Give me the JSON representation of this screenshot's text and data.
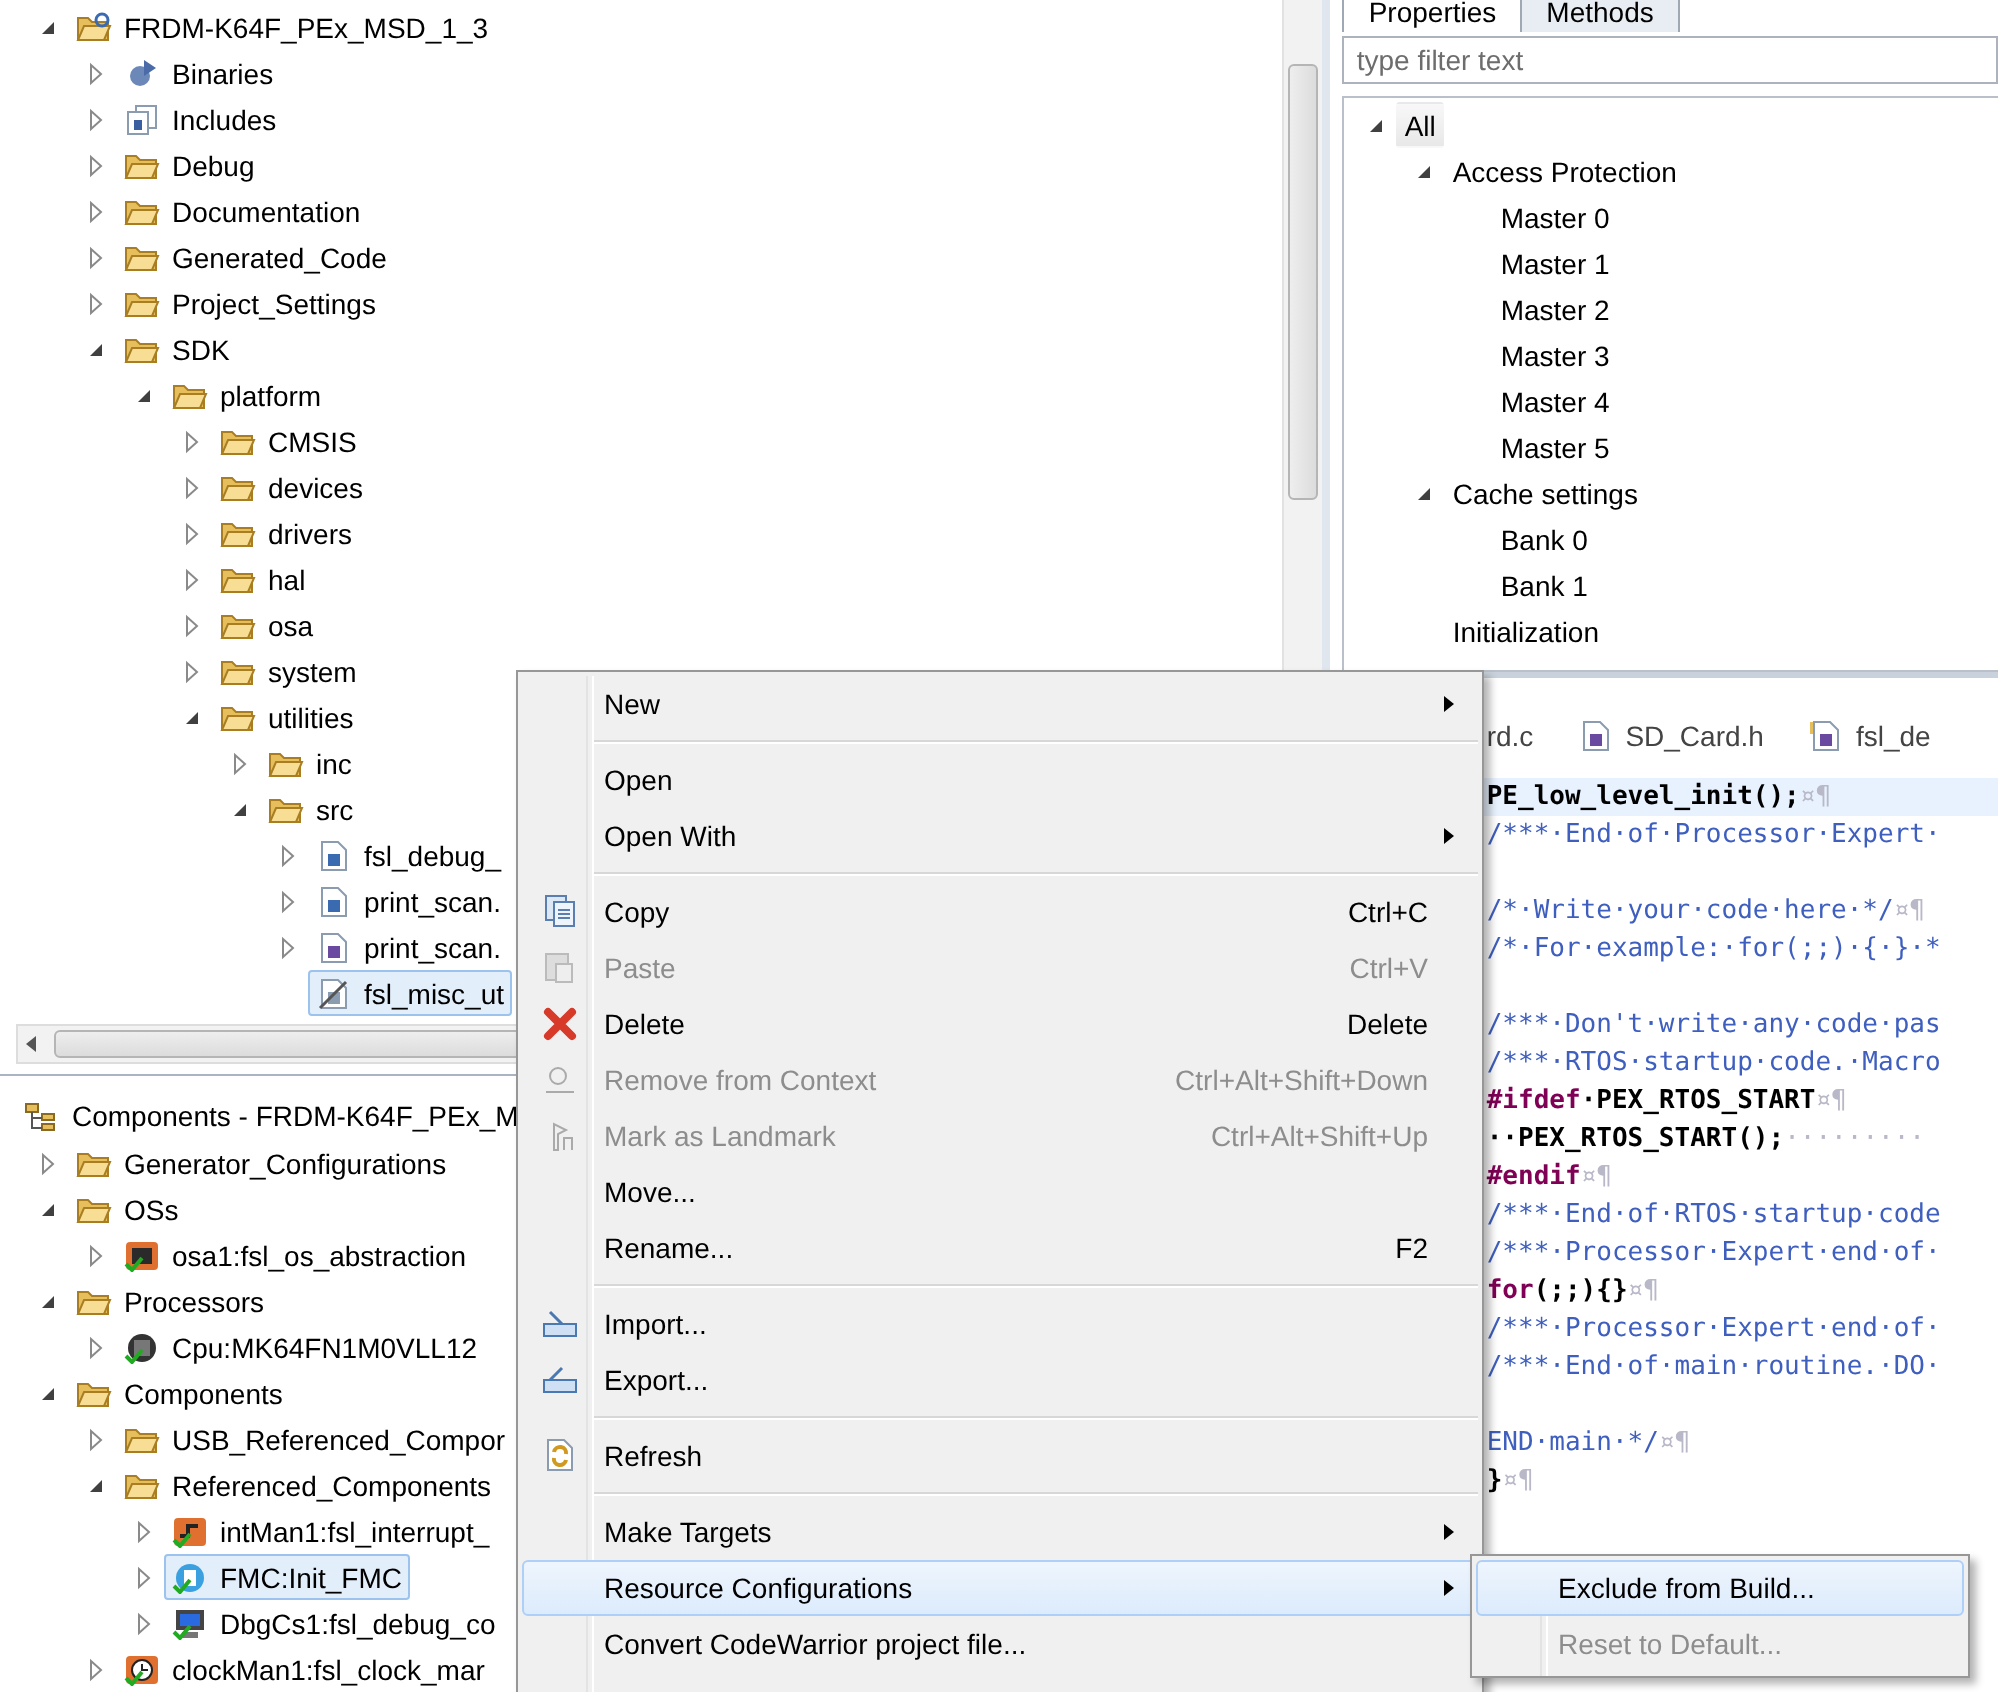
{
  "explorer": {
    "tree": [
      {
        "label": "FRDM-K64F_PEx_MSD_1_3",
        "kind": "project",
        "expanded": true,
        "selected": false,
        "children": [
          {
            "label": "Binaries",
            "kind": "binaries",
            "expanded": false,
            "selected": false
          },
          {
            "label": "Includes",
            "kind": "includes",
            "expanded": false,
            "selected": false
          },
          {
            "label": "Debug",
            "kind": "folder",
            "expanded": false,
            "selected": false
          },
          {
            "label": "Documentation",
            "kind": "folder",
            "expanded": false,
            "selected": false
          },
          {
            "label": "Generated_Code",
            "kind": "folder",
            "expanded": false,
            "selected": false
          },
          {
            "label": "Project_Settings",
            "kind": "folder",
            "expanded": false,
            "selected": false
          },
          {
            "label": "SDK",
            "kind": "folder",
            "expanded": true,
            "selected": false,
            "children": [
              {
                "label": "platform",
                "kind": "folder",
                "expanded": true,
                "selected": false,
                "children": [
                  {
                    "label": "CMSIS",
                    "kind": "folder",
                    "expanded": false,
                    "selected": false
                  },
                  {
                    "label": "devices",
                    "kind": "folder",
                    "expanded": false,
                    "selected": false
                  },
                  {
                    "label": "drivers",
                    "kind": "folder",
                    "expanded": false,
                    "selected": false
                  },
                  {
                    "label": "hal",
                    "kind": "folder",
                    "expanded": false,
                    "selected": false
                  },
                  {
                    "label": "osa",
                    "kind": "folder",
                    "expanded": false,
                    "selected": false
                  },
                  {
                    "label": "system",
                    "kind": "folder",
                    "expanded": false,
                    "selected": false
                  },
                  {
                    "label": "utilities",
                    "kind": "folder",
                    "expanded": true,
                    "selected": false,
                    "children": [
                      {
                        "label": "inc",
                        "kind": "folder",
                        "expanded": false,
                        "selected": false
                      },
                      {
                        "label": "src",
                        "kind": "folder",
                        "expanded": true,
                        "selected": false,
                        "children": [
                          {
                            "label": "fsl_debug_",
                            "kind": "c-file",
                            "expanded": false,
                            "selected": false
                          },
                          {
                            "label": "print_scan.",
                            "kind": "c-file",
                            "expanded": false,
                            "selected": false
                          },
                          {
                            "label": "print_scan.",
                            "kind": "h-file",
                            "expanded": false,
                            "selected": false
                          },
                          {
                            "label": "fsl_misc_ut",
                            "kind": "excluded-file",
                            "selected": true
                          }
                        ]
                      }
                    ]
                  }
                ]
              }
            ]
          }
        ]
      }
    ]
  },
  "components": {
    "title": "Components - FRDM-K64F_PEx_M",
    "tree": [
      {
        "label": "Generator_Configurations",
        "kind": "folder",
        "expanded": false,
        "selected": false
      },
      {
        "label": "OSs",
        "kind": "folder",
        "expanded": true,
        "selected": false,
        "children": [
          {
            "label": "osa1:fsl_os_abstraction",
            "kind": "os",
            "expanded": false,
            "selected": false
          }
        ]
      },
      {
        "label": "Processors",
        "kind": "folder",
        "expanded": true,
        "selected": false,
        "children": [
          {
            "label": "Cpu:MK64FN1M0VLL12",
            "kind": "cpu",
            "expanded": false,
            "selected": false
          }
        ]
      },
      {
        "label": "Components",
        "kind": "folder",
        "expanded": true,
        "selected": false,
        "children": [
          {
            "label": "USB_Referenced_Compor",
            "kind": "folder",
            "expanded": false,
            "selected": false
          },
          {
            "label": "Referenced_Components",
            "kind": "folder",
            "expanded": true,
            "selected": false,
            "children": [
              {
                "label": "intMan1:fsl_interrupt_",
                "kind": "interrupt",
                "expanded": false,
                "selected": false
              },
              {
                "label": "FMC:Init_FMC",
                "kind": "init",
                "expanded": false,
                "selected": true
              },
              {
                "label": "DbgCs1:fsl_debug_co",
                "kind": "console",
                "expanded": false,
                "selected": false
              }
            ]
          },
          {
            "label": "clockMan1:fsl_clock_mar",
            "kind": "clock",
            "expanded": false,
            "selected": false
          }
        ]
      }
    ]
  },
  "properties": {
    "tabs": [
      {
        "label": "Properties",
        "selected": true
      },
      {
        "label": "Methods",
        "selected": false
      }
    ],
    "filter": {
      "placeholder": "type filter text"
    },
    "tree": [
      {
        "label": "All",
        "expanded": true,
        "children": [
          {
            "label": "Access Protection",
            "expanded": true,
            "children": [
              {
                "label": "Master 0"
              },
              {
                "label": "Master 1"
              },
              {
                "label": "Master 2"
              },
              {
                "label": "Master 3"
              },
              {
                "label": "Master 4"
              },
              {
                "label": "Master 5"
              }
            ]
          },
          {
            "label": "Cache settings",
            "expanded": true,
            "children": [
              {
                "label": "Bank 0"
              },
              {
                "label": "Bank 1"
              }
            ]
          },
          {
            "label": "Initialization"
          }
        ]
      }
    ]
  },
  "editor": {
    "tabs": [
      {
        "label": "rd.c"
      },
      {
        "label": "SD_Card.h",
        "kind": "h-file"
      },
      {
        "label": "fsl_de",
        "kind": "h-lib"
      }
    ],
    "lines": [
      {
        "current": true,
        "parts": [
          {
            "text": "PE_low_level_init();",
            "kind": "code"
          },
          {
            "text": "¤¶",
            "kind": "mark"
          }
        ]
      },
      {
        "current": false,
        "parts": [
          {
            "text": "/***·End·of·Processor·Expert·",
            "kind": "comment"
          }
        ]
      },
      {
        "current": false
      },
      {
        "current": false,
        "parts": [
          {
            "text": "/*·Write·your·code·here·*/",
            "kind": "comment"
          },
          {
            "text": "¤¶",
            "kind": "mark"
          }
        ]
      },
      {
        "current": false,
        "parts": [
          {
            "text": "/*·For·example:·for(;;)·{·}·*",
            "kind": "comment"
          }
        ]
      },
      {
        "current": false
      },
      {
        "current": false,
        "parts": [
          {
            "text": "/***·Don't·write·any·code·pas",
            "kind": "comment"
          }
        ]
      },
      {
        "current": false,
        "parts": [
          {
            "text": "/***·RTOS·startup·code.·Macro",
            "kind": "comment"
          }
        ]
      },
      {
        "current": false,
        "parts": [
          {
            "text": "#ifdef",
            "kind": "keyword"
          },
          {
            "text": "·PEX_RTOS_START",
            "kind": "code"
          },
          {
            "text": "¤¶",
            "kind": "mark"
          }
        ]
      },
      {
        "current": false,
        "parts": [
          {
            "text": "··PEX_RTOS_START();",
            "kind": "code"
          },
          {
            "text": "·········",
            "kind": "mark"
          }
        ]
      },
      {
        "current": false,
        "parts": [
          {
            "text": "#endif",
            "kind": "keyword"
          },
          {
            "text": "¤¶",
            "kind": "mark"
          }
        ]
      },
      {
        "current": false,
        "parts": [
          {
            "text": "/***·End·of·RTOS·startup·code",
            "kind": "comment"
          }
        ]
      },
      {
        "current": false,
        "parts": [
          {
            "text": "/***·Processor·Expert·end·of·",
            "kind": "comment"
          }
        ]
      },
      {
        "current": false,
        "parts": [
          {
            "text": "for",
            "kind": "keyword"
          },
          {
            "text": "(;;){}",
            "kind": "code"
          },
          {
            "text": "¤¶",
            "kind": "mark"
          }
        ]
      },
      {
        "current": false,
        "parts": [
          {
            "text": "/***·Processor·Expert·end·of·",
            "kind": "comment"
          }
        ]
      },
      {
        "current": false,
        "parts": [
          {
            "text": "/***·End·of·main·routine.·DO·",
            "kind": "comment"
          }
        ]
      },
      {
        "current": false
      },
      {
        "current": false,
        "parts": [
          {
            "text": "END·main·*/",
            "kind": "comment"
          },
          {
            "text": "¤¶",
            "kind": "mark"
          }
        ]
      },
      {
        "current": false,
        "parts": [
          {
            "text": "}",
            "kind": "code"
          },
          {
            "text": "¤¶",
            "kind": "mark"
          }
        ]
      }
    ]
  },
  "context_menu": {
    "items": [
      {
        "kind": "item",
        "label": "New",
        "submenu": true,
        "disabled": false,
        "selected": false
      },
      {
        "kind": "separator"
      },
      {
        "kind": "item",
        "label": "Open",
        "submenu": false,
        "disabled": false,
        "selected": false
      },
      {
        "kind": "item",
        "label": "Open With",
        "submenu": true,
        "disabled": false,
        "selected": false
      },
      {
        "kind": "separator"
      },
      {
        "kind": "item",
        "label": "Copy",
        "shortcut": "Ctrl+C",
        "submenu": false,
        "disabled": false,
        "selected": false
      },
      {
        "kind": "item",
        "label": "Paste",
        "shortcut": "Ctrl+V",
        "submenu": false,
        "disabled": true,
        "selected": false
      },
      {
        "kind": "item",
        "label": "Delete",
        "shortcut": "Delete",
        "submenu": false,
        "disabled": false,
        "selected": false
      },
      {
        "kind": "item",
        "label": "Remove from Context",
        "shortcut": "Ctrl+Alt+Shift+Down",
        "submenu": false,
        "disabled": true,
        "selected": false
      },
      {
        "kind": "item",
        "label": "Mark as Landmark",
        "shortcut": "Ctrl+Alt+Shift+Up",
        "submenu": false,
        "disabled": true,
        "selected": false
      },
      {
        "kind": "item",
        "label": "Move...",
        "submenu": false,
        "disabled": false,
        "selected": false
      },
      {
        "kind": "item",
        "label": "Rename...",
        "shortcut": "F2",
        "submenu": false,
        "disabled": false,
        "selected": false
      },
      {
        "kind": "separator"
      },
      {
        "kind": "item",
        "label": "Import...",
        "submenu": false,
        "disabled": false,
        "selected": false
      },
      {
        "kind": "item",
        "label": "Export...",
        "submenu": false,
        "disabled": false,
        "selected": false
      },
      {
        "kind": "separator"
      },
      {
        "kind": "item",
        "label": "Refresh",
        "submenu": false,
        "disabled": false,
        "selected": false
      },
      {
        "kind": "separator"
      },
      {
        "kind": "item",
        "label": "Make Targets",
        "submenu": true,
        "disabled": false,
        "selected": false
      },
      {
        "kind": "item",
        "label": "Resource Configurations",
        "submenu": true,
        "disabled": false,
        "selected": true
      },
      {
        "kind": "item",
        "label": "Convert CodeWarrior project file...",
        "submenu": false,
        "disabled": false,
        "selected": false
      }
    ]
  },
  "submenu": {
    "items": [
      {
        "label": "Exclude from Build...",
        "disabled": false,
        "selected": true
      },
      {
        "label": "Reset to Default...",
        "disabled": true,
        "selected": false
      }
    ]
  }
}
